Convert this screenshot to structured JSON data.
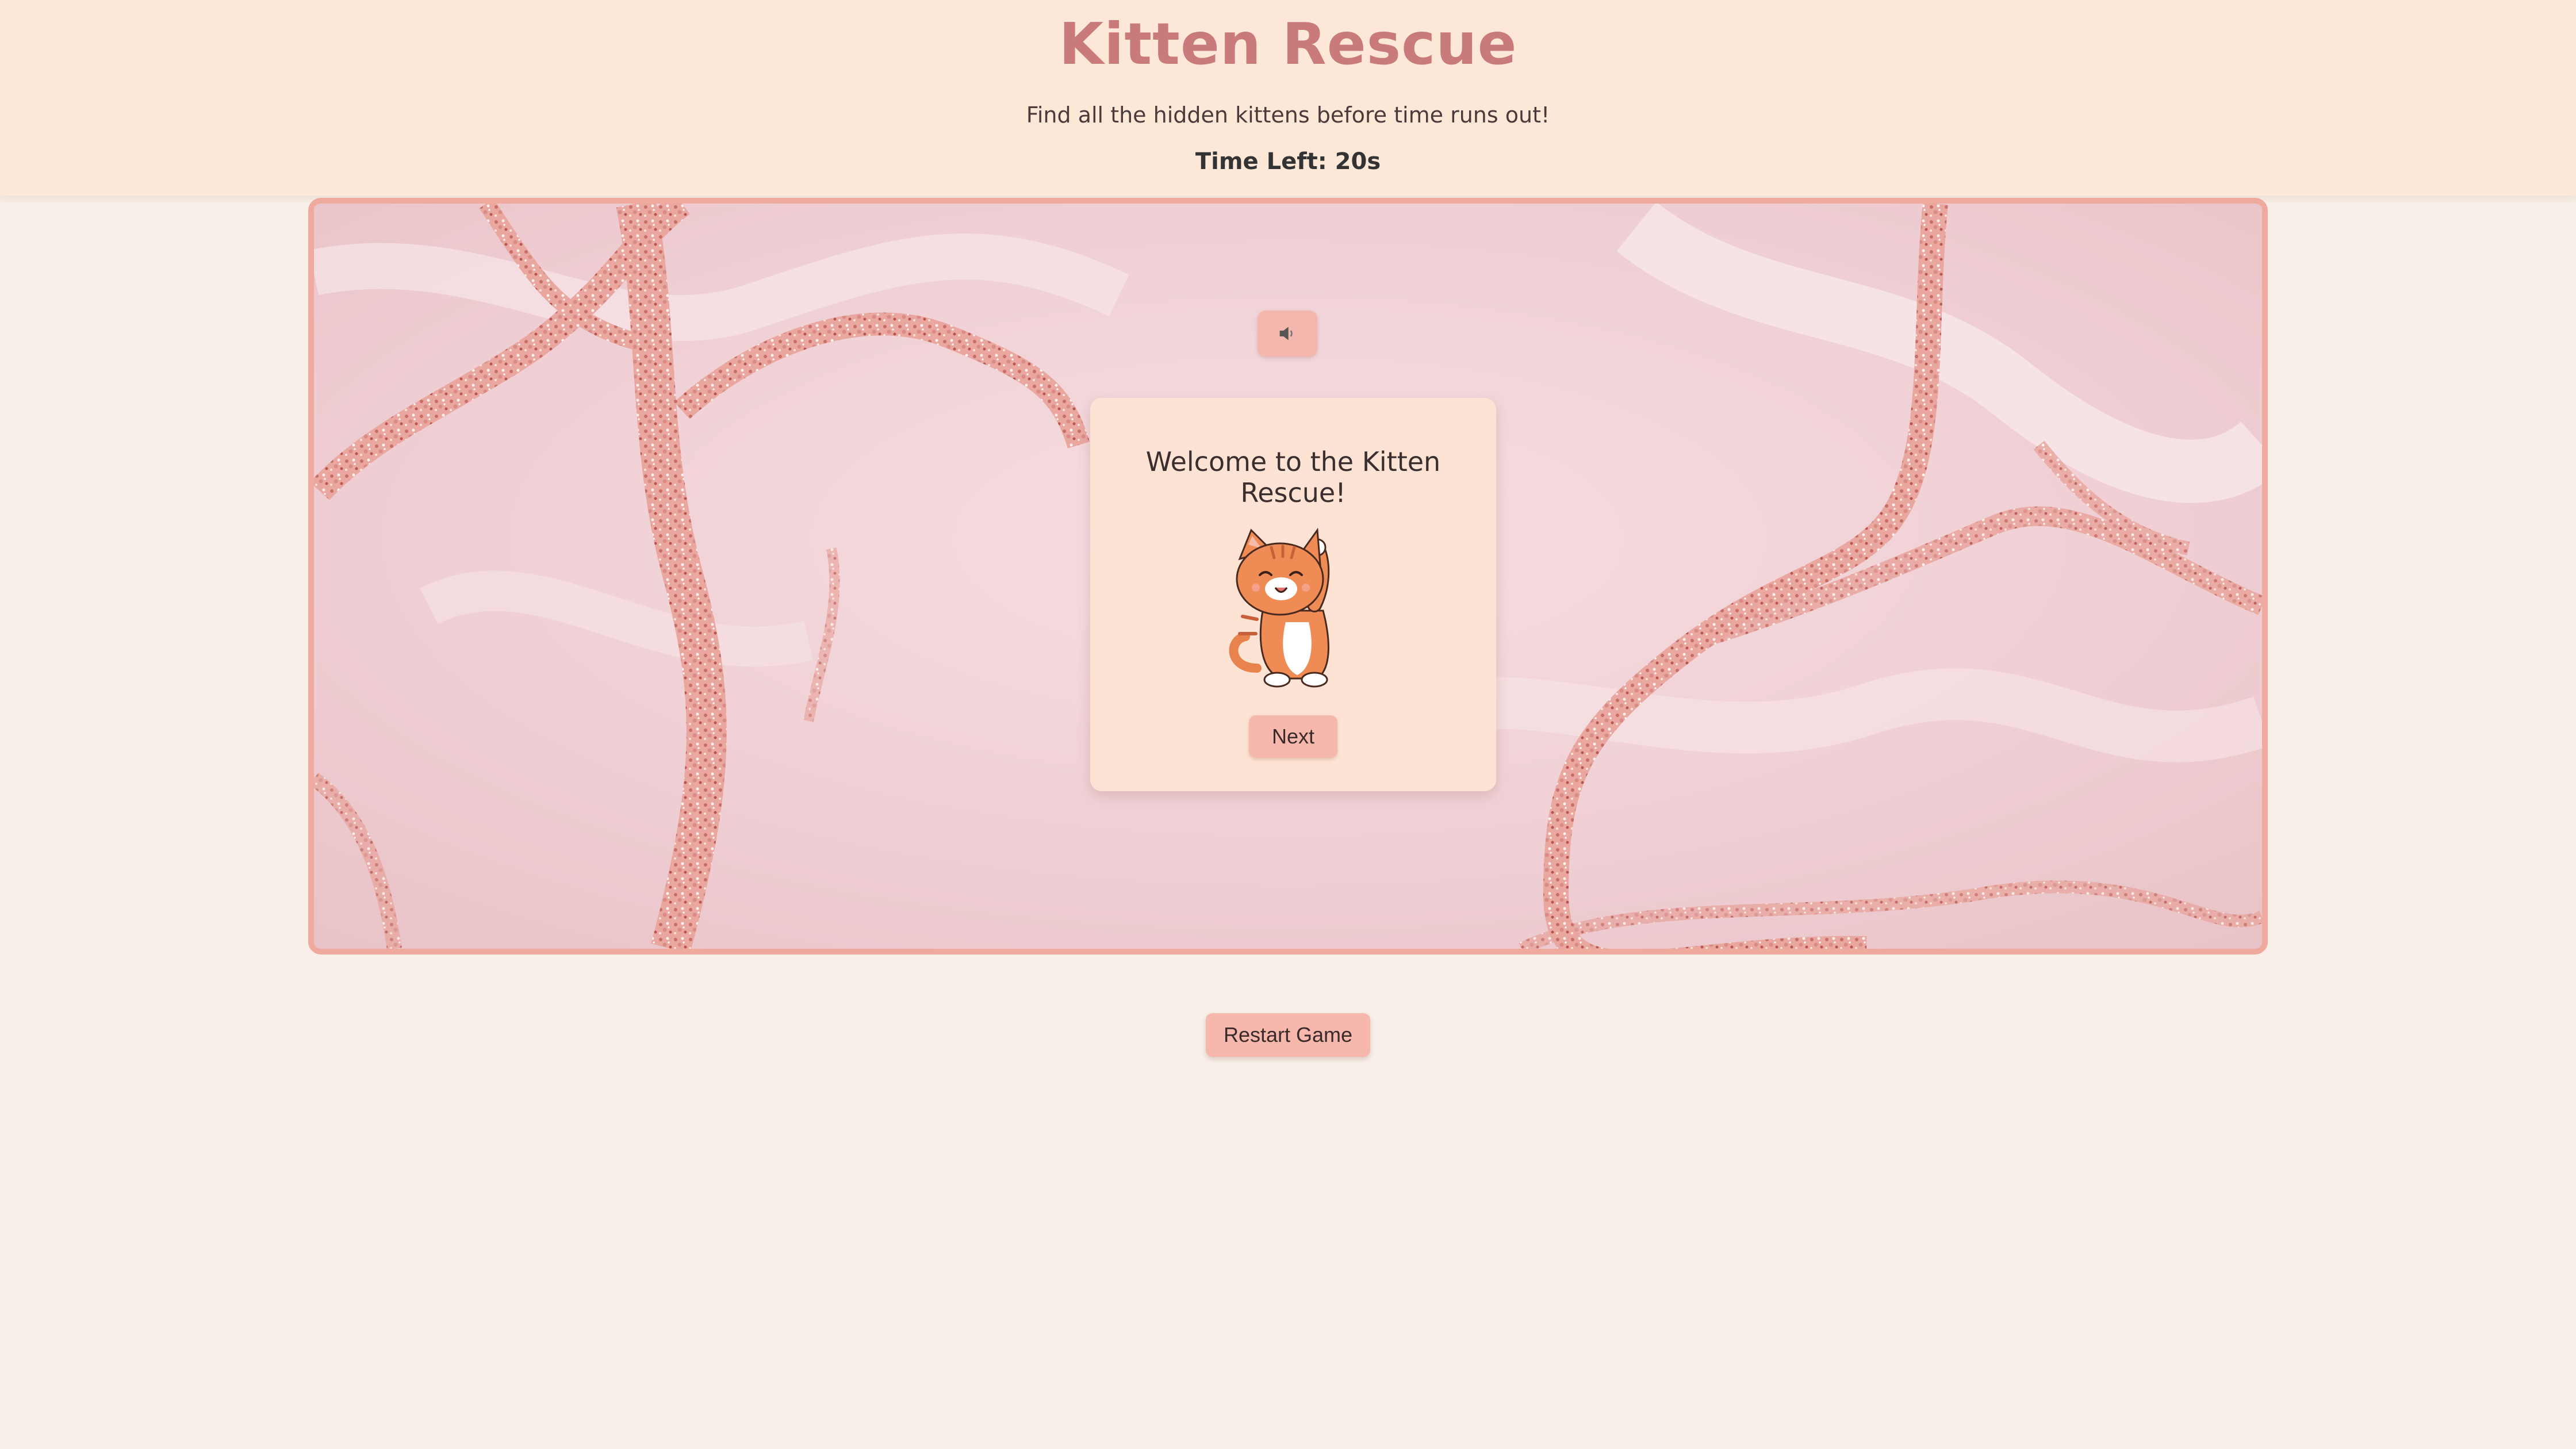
{
  "header": {
    "title": "Kitten Rescue",
    "subtitle": "Find all the hidden kittens before time runs out!",
    "timer_label": "Time Left:",
    "time_left": "20s",
    "timer_text": "Time Left: 20s"
  },
  "game": {
    "sound_icon": "speaker-icon",
    "modal": {
      "title": "Welcome to the Kitten Rescue!",
      "image": "waving-kitten",
      "next_label": "Next"
    }
  },
  "controls": {
    "restart_label": "Restart Game"
  },
  "colors": {
    "title": "#c97a7a",
    "header_bg": "#fde8d8",
    "page_bg": "#f7efe8",
    "button": "#f6b8ad",
    "game_border": "#eeaa9c",
    "modal_bg": "#fde3d3"
  }
}
